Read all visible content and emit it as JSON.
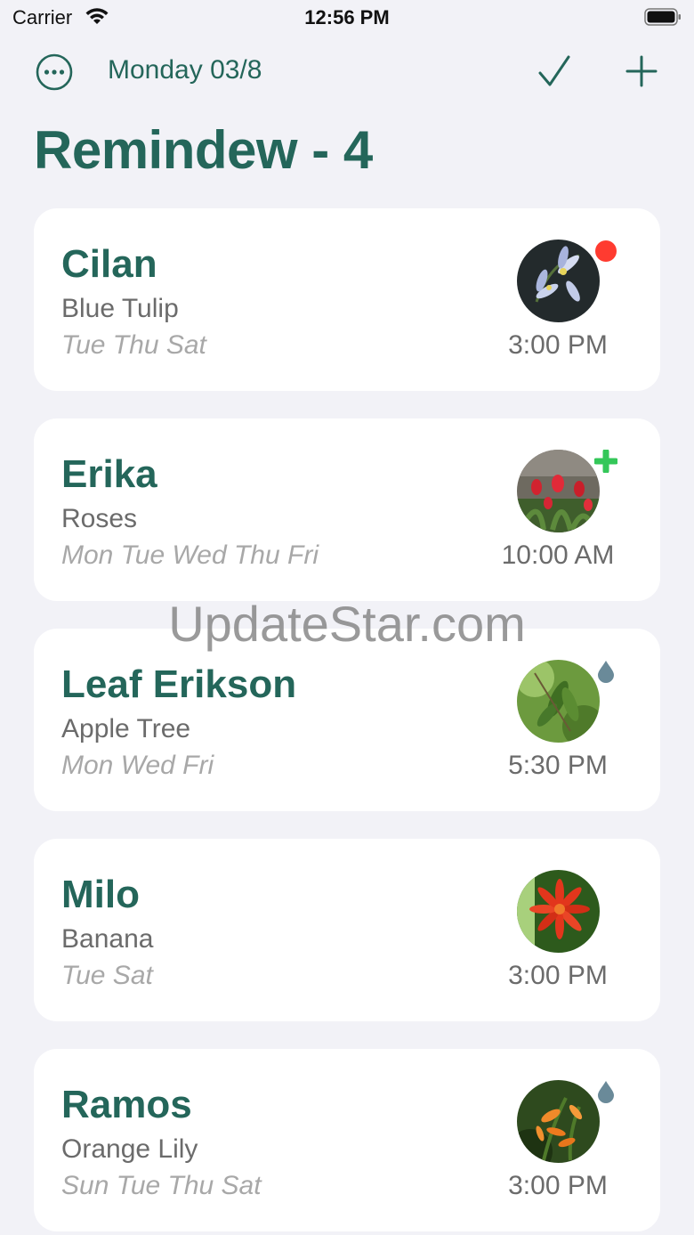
{
  "status_bar": {
    "carrier": "Carrier",
    "time": "12:56 PM"
  },
  "nav": {
    "date": "Monday 03/8",
    "more_icon": "ellipsis-circle-icon",
    "check_icon": "checkmark-icon",
    "add_icon": "plus-icon"
  },
  "title": "Remindew - 4",
  "colors": {
    "accent": "#24665a",
    "background": "#f2f2f7",
    "badge_red": "#ff3b30",
    "badge_green": "#34c759",
    "badge_water": "#6a8a99"
  },
  "reminders": [
    {
      "name": "Cilan",
      "plant": "Blue Tulip",
      "days": "Tue Thu Sat",
      "time": "3:00 PM",
      "badge": "red-dot-icon"
    },
    {
      "name": "Erika",
      "plant": "Roses",
      "days": "Mon Tue Wed Thu Fri",
      "time": "10:00 AM",
      "badge": "green-plus-icon"
    },
    {
      "name": "Leaf Erikson",
      "plant": "Apple Tree",
      "days": "Mon Wed Fri",
      "time": "5:30 PM",
      "badge": "water-drop-icon"
    },
    {
      "name": "Milo",
      "plant": "Banana",
      "days": "Tue Sat",
      "time": "3:00 PM",
      "badge": ""
    },
    {
      "name": "Ramos",
      "plant": "Orange Lily",
      "days": "Sun Tue Thu Sat",
      "time": "3:00 PM",
      "badge": "water-drop-icon"
    }
  ],
  "watermark": "UpdateStar.com"
}
